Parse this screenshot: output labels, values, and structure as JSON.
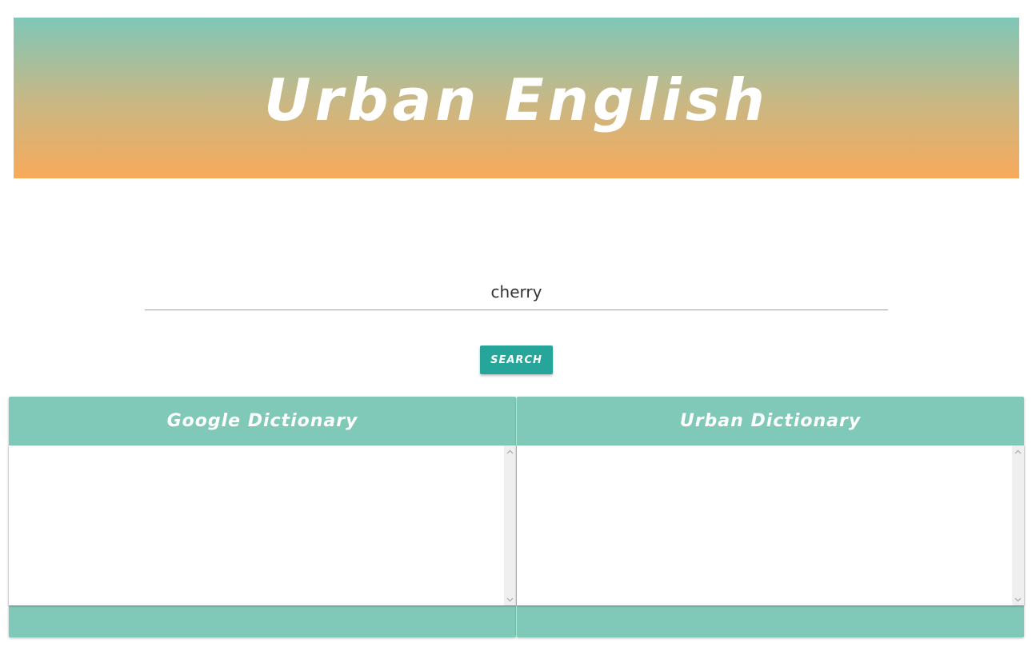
{
  "header": {
    "title": "Urban English"
  },
  "search": {
    "value": "cherry",
    "button_label": "SEARCH"
  },
  "panels": [
    {
      "title": "Google Dictionary",
      "content": ""
    },
    {
      "title": "Urban Dictionary",
      "content": ""
    }
  ],
  "colors": {
    "accent": "#26a69a",
    "panel": "#80c8b8",
    "banner_top": "#7fc7b8",
    "banner_bottom": "#f8aa5a"
  },
  "icons": {
    "scroll_up": "chevron-up-icon",
    "scroll_down": "chevron-down-icon"
  }
}
